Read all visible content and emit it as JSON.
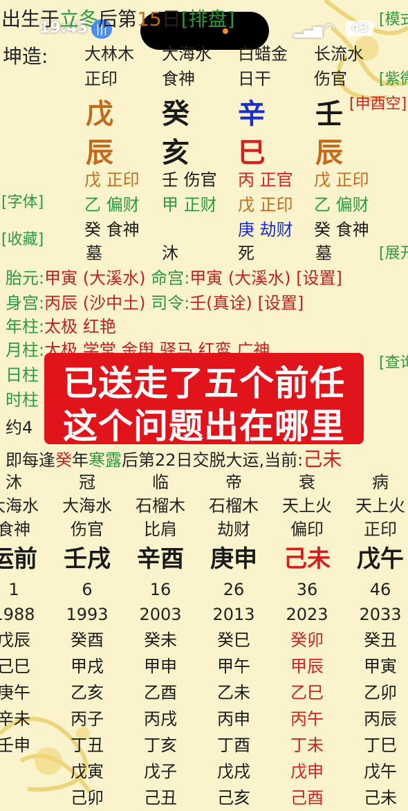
{
  "status_bar": {
    "time": "19:43",
    "battery": "43"
  },
  "header": {
    "prefix": "出生于",
    "solar_term": "立冬",
    "after": "后第",
    "day_num": "15",
    "day_suffix": "日",
    "tag_paipan": "[排盘]",
    "tag_mode": "[模式]"
  },
  "gender_label": "坤造:",
  "nayin_row": [
    "大林木",
    "大海水",
    "白蜡金",
    "长流水"
  ],
  "shishen_row": [
    "正印",
    "食神",
    "日干",
    "伤官"
  ],
  "tiangan": [
    "戊",
    "癸",
    "辛",
    "壬"
  ],
  "dizhi": [
    "辰",
    "亥",
    "巳",
    "辰"
  ],
  "kongwang": "[申酉空]",
  "tag_purple": "[紫微]",
  "hidden": [
    [
      "戊 正印",
      "壬 伤官",
      "丙 正官",
      "戊 正印"
    ],
    [
      "乙 偏财",
      "甲 正财",
      "戊 正印",
      "乙 偏财"
    ],
    [
      "癸 食神",
      "",
      "庚 劫财",
      "癸 食神"
    ]
  ],
  "changsheng": [
    "墓",
    "沐",
    "死",
    "墓"
  ],
  "side_tags": {
    "font": "[字体]",
    "favorite": "[收藏]",
    "expand": "[展开]",
    "query": "[查询]"
  },
  "info": {
    "taiyuan_label": "胎元:",
    "taiyuan_val": "甲寅 (大溪水)",
    "minggong_label": "命宫:",
    "minggong_val": "甲寅 (大溪水)",
    "set1": "[设置]",
    "shengong_label": "身宫:",
    "shengong_val": "丙辰 (沙中土)",
    "siling_label": "司令:",
    "siling_val": "壬(真诠)",
    "set2": "[设置]",
    "nianzhu_label": "年柱:",
    "nianzhu_val": "太极 红艳",
    "yuezhu_label": "月柱:",
    "yuezhu_val": "太极 学堂 金舆 驿马 红鸾 广神",
    "rizhu_label": "日柱",
    "shizhu_label": "时柱",
    "yue_label": "约4"
  },
  "overlay": {
    "line1": "已送走了五个前任",
    "line2": "这个问题出在哪里"
  },
  "jiaoyun": {
    "prefix": "即每逢",
    "gan": "癸",
    "year": "年",
    "term": "寒露",
    "after": "后第22日交脱大运,当前:",
    "current": "己未"
  },
  "dayun": [
    {
      "cs": "沐",
      "nayin": "大海水",
      "ss": "食神",
      "gz": "运前",
      "age": "1",
      "year": "1988",
      "years": [
        "戊辰",
        "己巳",
        "庚午",
        "辛未",
        "壬申",
        "",
        ""
      ],
      "current": false
    },
    {
      "cs": "冠",
      "nayin": "大海水",
      "ss": "伤官",
      "gz": "壬戌",
      "age": "6",
      "year": "1993",
      "years": [
        "癸酉",
        "甲戌",
        "乙亥",
        "丙子",
        "丁丑",
        "戊寅",
        "己卯"
      ],
      "current": false
    },
    {
      "cs": "临",
      "nayin": "石榴木",
      "ss": "比肩",
      "gz": "辛酉",
      "age": "16",
      "year": "2003",
      "years": [
        "癸未",
        "甲申",
        "乙酉",
        "丙戌",
        "丁亥",
        "戊子",
        "己丑"
      ],
      "current": false
    },
    {
      "cs": "帝",
      "nayin": "石榴木",
      "ss": "劫财",
      "gz": "庚申",
      "age": "26",
      "year": "2013",
      "years": [
        "癸巳",
        "甲午",
        "乙未",
        "丙申",
        "丁酉",
        "戊戌",
        "己亥"
      ],
      "current": false
    },
    {
      "cs": "衰",
      "nayin": "天上火",
      "ss": "偏印",
      "gz": "己未",
      "age": "36",
      "year": "2023",
      "years": [
        "癸卯",
        "甲辰",
        "乙巳",
        "丙午",
        "丁未",
        "戊申",
        "己酉"
      ],
      "current": true
    },
    {
      "cs": "病",
      "nayin": "天上火",
      "ss": "正印",
      "gz": "戊午",
      "age": "46",
      "year": "2033",
      "years": [
        "癸丑",
        "甲寅",
        "乙卯",
        "丙辰",
        "丁巳",
        "戊午",
        "己未"
      ],
      "current": false
    }
  ],
  "colors": {
    "green": "#2a9a3c",
    "red": "#d22020",
    "orange": "#c26a1e",
    "blue": "#1a2ccc",
    "overlay": "#e0141a"
  }
}
